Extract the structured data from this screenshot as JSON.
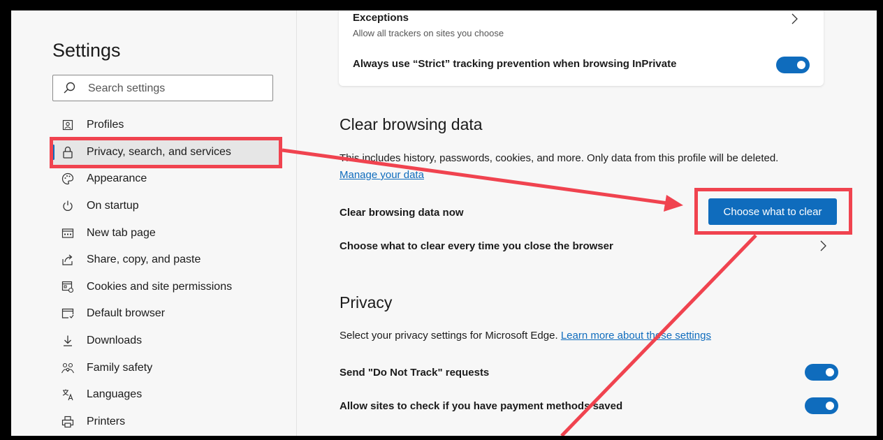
{
  "sidebar": {
    "title": "Settings",
    "search_placeholder": "Search settings",
    "items": [
      {
        "label": "Profiles",
        "icon": "profile-icon"
      },
      {
        "label": "Privacy, search, and services",
        "icon": "lock-icon"
      },
      {
        "label": "Appearance",
        "icon": "palette-icon"
      },
      {
        "label": "On startup",
        "icon": "power-icon"
      },
      {
        "label": "New tab page",
        "icon": "new-tab-icon"
      },
      {
        "label": "Share, copy, and paste",
        "icon": "share-icon"
      },
      {
        "label": "Cookies and site permissions",
        "icon": "cookies-icon"
      },
      {
        "label": "Default browser",
        "icon": "browser-icon"
      },
      {
        "label": "Downloads",
        "icon": "download-icon"
      },
      {
        "label": "Family safety",
        "icon": "family-icon"
      },
      {
        "label": "Languages",
        "icon": "language-icon"
      },
      {
        "label": "Printers",
        "icon": "printer-icon"
      }
    ],
    "active_index": 1
  },
  "tracking": {
    "exceptions_title": "Exceptions",
    "exceptions_desc": "Allow all trackers on sites you choose",
    "strict_label": "Always use “Strict” tracking prevention when browsing InPrivate",
    "strict_on": true
  },
  "clear": {
    "heading": "Clear browsing data",
    "desc": "This includes history, passwords, cookies, and more. Only data from this profile will be deleted.",
    "manage_link": "Manage your data",
    "now_label": "Clear browsing data now",
    "button": "Choose what to clear",
    "every_time_label": "Choose what to clear every time you close the browser"
  },
  "privacy": {
    "heading": "Privacy",
    "desc": "Select your privacy settings for Microsoft Edge.",
    "learn_link": "Learn more about these settings",
    "dnt_label": "Send \"Do Not Track\" requests",
    "dnt_on": true,
    "payment_label": "Allow sites to check if you have payment methods saved",
    "payment_on": true
  },
  "colors": {
    "accent": "#0f6cbd",
    "annotation": "#f0434f"
  }
}
